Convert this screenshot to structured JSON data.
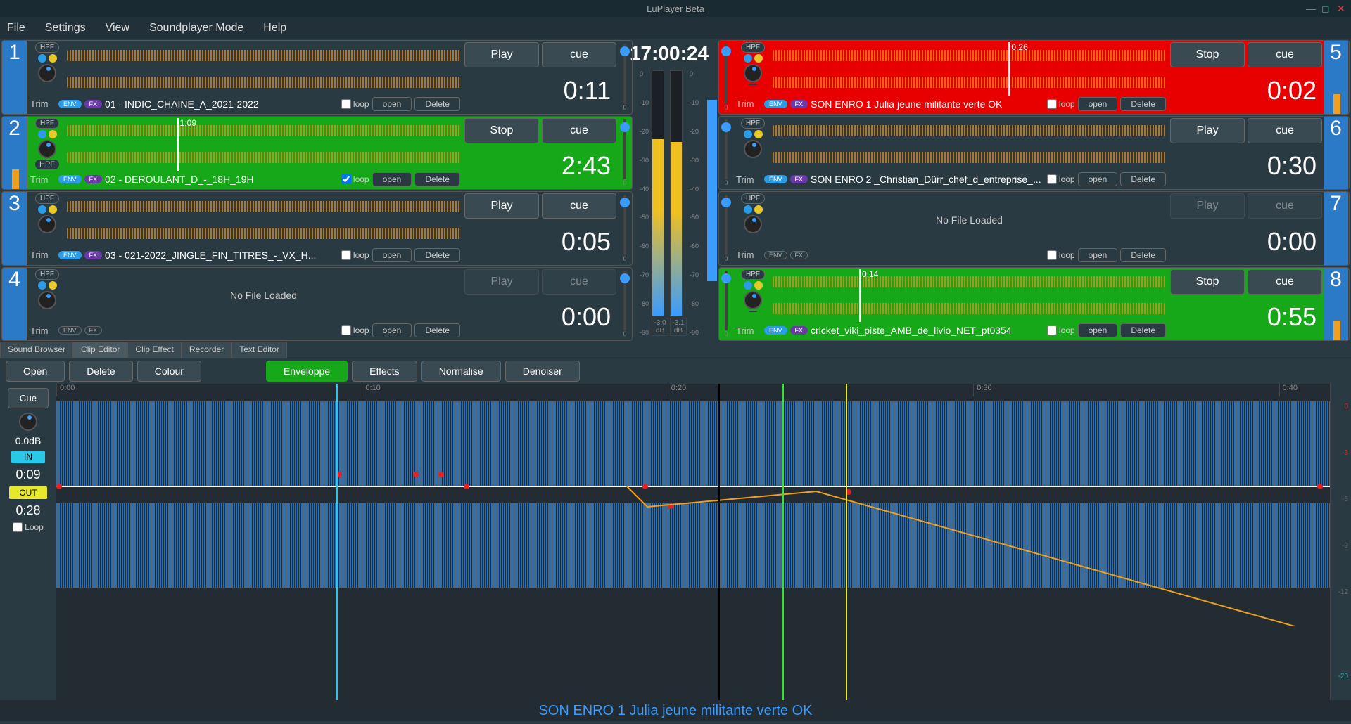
{
  "app": {
    "title": "LuPlayer Beta"
  },
  "menu": {
    "file": "File",
    "settings": "Settings",
    "view": "View",
    "soundplayer_mode": "Soundplayer Mode",
    "help": "Help"
  },
  "clock": "17:00:24",
  "meters": {
    "left_db": "-3.0 dB",
    "right_db": "-3.1 dB",
    "scale": [
      "0",
      "-10",
      "-20",
      "-30",
      "-40",
      "-50",
      "-60",
      "-70",
      "-80",
      "-90"
    ]
  },
  "labels": {
    "hpf": "HPF",
    "trim": "Trim",
    "env": "ENV",
    "fx": "FX",
    "loop": "loop",
    "open": "open",
    "delete": "Delete",
    "play": "Play",
    "stop": "Stop",
    "cue": "cue",
    "no_file": "No File Loaded",
    "fader_zero": "0"
  },
  "players": [
    {
      "slot": "1",
      "state": "idle",
      "filename": "01 - INDIC_CHAINE_A_2021-2022",
      "time": "0:11",
      "loop": false,
      "btn1": "Play",
      "btn1_disabled": false,
      "playhead_pct": 0,
      "playhead_label": "",
      "loaded": true
    },
    {
      "slot": "2",
      "state": "playing",
      "filename": "02 - DEROULANT_D_-_18H_19H",
      "time": "2:43",
      "loop": true,
      "btn1": "Stop",
      "btn1_disabled": false,
      "playhead_pct": 28,
      "playhead_label": "1:09",
      "loaded": true
    },
    {
      "slot": "3",
      "state": "idle",
      "filename": "03 - 021-2022_JINGLE_FIN_TITRES_-_VX_H...",
      "time": "0:05",
      "loop": false,
      "btn1": "Play",
      "btn1_disabled": false,
      "playhead_pct": 0,
      "playhead_label": "",
      "loaded": true
    },
    {
      "slot": "4",
      "state": "idle",
      "filename": "",
      "time": "0:00",
      "loop": false,
      "btn1": "Play",
      "btn1_disabled": true,
      "playhead_pct": 0,
      "playhead_label": "",
      "loaded": false
    },
    {
      "slot": "5",
      "state": "active",
      "filename": "SON ENRO 1 Julia  jeune militante verte OK",
      "time": "0:02",
      "loop": false,
      "btn1": "Stop",
      "btn1_disabled": false,
      "playhead_pct": 60,
      "playhead_label": "0:26",
      "loaded": true
    },
    {
      "slot": "6",
      "state": "idle",
      "filename": "SON ENRO 2 _Christian_Dürr_chef_d_entreprise_...",
      "time": "0:30",
      "loop": false,
      "btn1": "Play",
      "btn1_disabled": false,
      "playhead_pct": 0,
      "playhead_label": "",
      "loaded": true
    },
    {
      "slot": "7",
      "state": "idle",
      "filename": "",
      "time": "0:00",
      "loop": false,
      "btn1": "Play",
      "btn1_disabled": true,
      "playhead_pct": 0,
      "playhead_label": "",
      "loaded": false
    },
    {
      "slot": "8",
      "state": "playing",
      "filename": "cricket_viki_piste_AMB_de_livio_NET_pt0354",
      "time": "0:55",
      "loop": false,
      "btn1": "Stop",
      "btn1_disabled": false,
      "playhead_pct": 22,
      "playhead_label": "0:14",
      "loaded": true
    }
  ],
  "tabs": {
    "sound_browser": "Sound Browser",
    "clip_editor": "Clip Editor",
    "clip_effect": "Clip Effect",
    "recorder": "Recorder",
    "text_editor": "Text Editor"
  },
  "editor": {
    "toolbar": {
      "open": "Open",
      "delete": "Delete",
      "colour": "Colour",
      "enveloppe": "Enveloppe",
      "effects": "Effects",
      "normalise": "Normalise",
      "denoiser": "Denoiser"
    },
    "cue": "Cue",
    "db": "0.0dB",
    "in_label": "IN",
    "in_time": "0:09",
    "out_label": "OUT",
    "out_time": "0:28",
    "loop_label": "Loop",
    "ticks": [
      "0:00",
      "0:10",
      "0:20",
      "0:30",
      "0:40"
    ],
    "right_scale": [
      "0",
      "-3",
      "-6",
      "-9",
      "-12",
      "",
      "-20"
    ],
    "filename": "SON ENRO 1 Julia  jeune militante verte OK"
  }
}
